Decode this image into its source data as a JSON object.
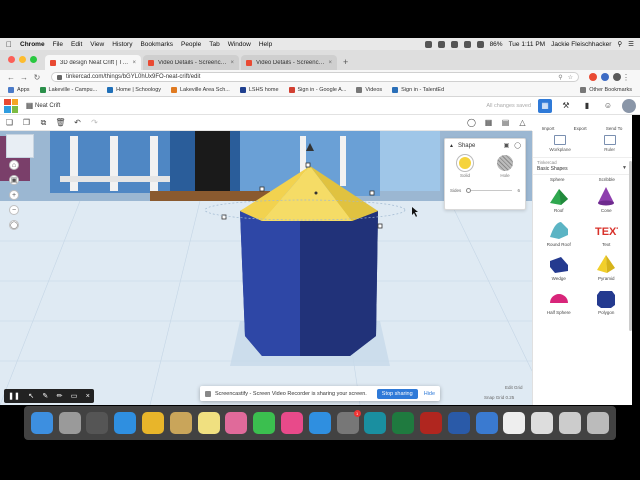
{
  "menubar": {
    "apple": "",
    "items": [
      "Chrome",
      "File",
      "Edit",
      "View",
      "History",
      "Bookmarks",
      "People",
      "Tab",
      "Window",
      "Help"
    ],
    "battery": "86%",
    "clock": "Tue 1:11 PM",
    "user": "Jackie Fleischhacker"
  },
  "tabs": [
    {
      "title": "3D design Neat Crift | Tinkercad",
      "active": true,
      "favicon_color": "#e94a33"
    },
    {
      "title": "Video Details - Screencastify",
      "active": false,
      "favicon_color": "#e94a33"
    },
    {
      "title": "Video Details - Screencastify",
      "active": false,
      "favicon_color": "#e94a33"
    }
  ],
  "address": {
    "url": "tinkercad.com/things/bGYL0hUx9FO-neat-crift/edit"
  },
  "bookmarks": {
    "items": [
      "Apps",
      "Lakeville - Campu...",
      "Home | Schoology",
      "Lakeville Area Sch...",
      "LSHS home",
      "Sign in - Google A...",
      "Videos",
      "Sign in - TalentEd"
    ],
    "other": "Other Bookmarks"
  },
  "tinkercad": {
    "design_name": "Neat Crift",
    "status": "All changes saved",
    "header_buttons": [
      "Import",
      "Export",
      "Send To"
    ],
    "logo_colors": [
      "#e94a33",
      "#f5a623",
      "#2f9de0",
      "#7dbb42"
    ]
  },
  "inspector": {
    "title": "Shape",
    "solid_label": "Solid",
    "hole_label": "Hole",
    "sides_label": "Sides",
    "sides_value": "6"
  },
  "panel": {
    "top_items": [
      "Workplane",
      "Ruler"
    ],
    "category_label": "Tinkercad",
    "category_value": "Basic Shapes",
    "partial_labels": [
      "Sphere",
      "Scribble"
    ],
    "shapes": [
      {
        "label": "Roof",
        "color": "#2fa84f"
      },
      {
        "label": "Cone",
        "color": "#8e3fae"
      },
      {
        "label": "Round Roof",
        "color": "#5bb4c4"
      },
      {
        "label": "Text",
        "color": "#d8312a"
      },
      {
        "label": "Wedge",
        "color": "#243a8f"
      },
      {
        "label": "Pyramid",
        "color": "#f2cf2a"
      },
      {
        "label": "Half Sphere",
        "color": "#d8257a"
      },
      {
        "label": "Polygon",
        "color": "#243a8f"
      }
    ]
  },
  "viewport": {
    "body_color": "#25398a",
    "roof_color": "#f2d24f"
  },
  "sharebar": {
    "message": "Screencastify - Screen Video Recorder is sharing your screen.",
    "stop": "Stop sharing",
    "hide": "Hide"
  },
  "grid": {
    "edit_grid": "Edit Grid",
    "snap_grid": "Snap Grid",
    "snap_value": "0.25"
  },
  "dock": {
    "apps": [
      {
        "name": "finder",
        "color": "#3d8fe0"
      },
      {
        "name": "launchpad",
        "color": "#9a9a9a"
      },
      {
        "name": "rocket",
        "color": "#555"
      },
      {
        "name": "safari",
        "color": "#2f8fe0"
      },
      {
        "name": "chrome",
        "color": "#e8b52a"
      },
      {
        "name": "notes",
        "color": "#c9a55a"
      },
      {
        "name": "stickies",
        "color": "#f0e080"
      },
      {
        "name": "photos",
        "color": "#e06a9a"
      },
      {
        "name": "messages",
        "color": "#3bbf4f"
      },
      {
        "name": "itunes",
        "color": "#e84a8a"
      },
      {
        "name": "app-store",
        "color": "#2f8fe0"
      },
      {
        "name": "system-preferences",
        "color": "#777",
        "badge": "1"
      },
      {
        "name": "arduino",
        "color": "#1a8fa0"
      },
      {
        "name": "excel",
        "color": "#1f7a3f"
      },
      {
        "name": "acrobat",
        "color": "#b0261f"
      },
      {
        "name": "word",
        "color": "#2a5aa8"
      },
      {
        "name": "network",
        "color": "#3a7ad0"
      },
      {
        "name": "document",
        "color": "#eee"
      },
      {
        "name": "preview",
        "color": "#ddd"
      },
      {
        "name": "screenshot",
        "color": "#ccc"
      },
      {
        "name": "trash",
        "color": "#bbb"
      }
    ]
  }
}
